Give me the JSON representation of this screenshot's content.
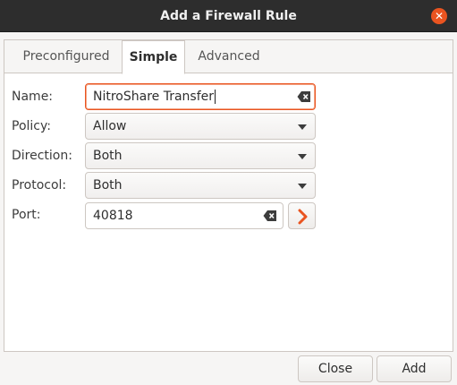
{
  "window": {
    "title": "Add a Firewall Rule"
  },
  "tabs": [
    {
      "label": "Preconfigured",
      "active": false
    },
    {
      "label": "Simple",
      "active": true
    },
    {
      "label": "Advanced",
      "active": false
    }
  ],
  "form": {
    "name": {
      "label": "Name:",
      "value": "NitroShare Transfer"
    },
    "policy": {
      "label": "Policy:",
      "value": "Allow"
    },
    "direction": {
      "label": "Direction:",
      "value": "Both"
    },
    "protocol": {
      "label": "Protocol:",
      "value": "Both"
    },
    "port": {
      "label": "Port:",
      "value": "40818"
    }
  },
  "buttons": {
    "close": "Close",
    "add": "Add"
  },
  "colors": {
    "accent": "#e95420",
    "titlebar": "#2d2d2d"
  },
  "icons": {
    "window_close": "close-icon",
    "entry_clear": "backspace-clear-icon",
    "go": "chevron-right-icon",
    "dropdown": "chevron-down-icon"
  }
}
